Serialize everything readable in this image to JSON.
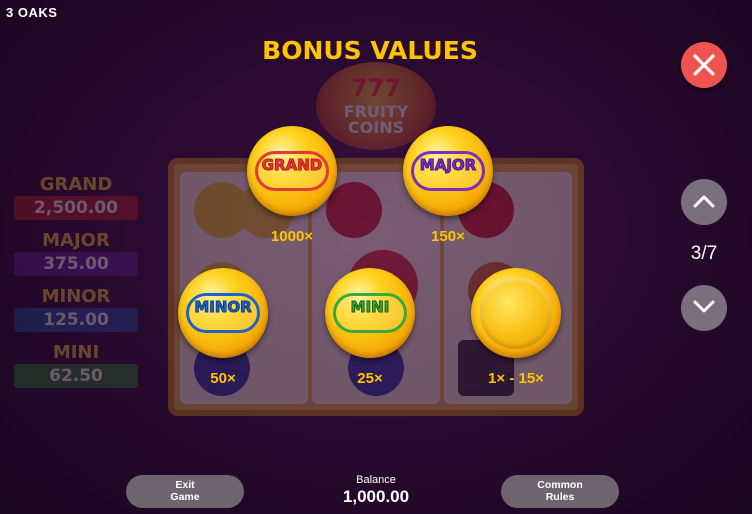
{
  "game": {
    "name": "3 OAKS"
  },
  "title": "BONUS VALUES",
  "pagination": {
    "indicator": "3/7"
  },
  "coins": [
    {
      "label": "GRAND",
      "multiplier": "1000×",
      "ring_color": "#e53935",
      "label_stroke": "#b71c1c"
    },
    {
      "label": "MAJOR",
      "multiplier": "150×",
      "ring_color": "#7b2fbe",
      "label_stroke": "#4a148c"
    },
    {
      "label": "MINOR",
      "multiplier": "50×",
      "ring_color": "#1e63c8",
      "label_stroke": "#0d3c8a"
    },
    {
      "label": "MINI",
      "multiplier": "25×",
      "ring_color": "#3aa83a",
      "label_stroke": "#1b5e20"
    },
    {
      "label": "",
      "multiplier": "1× - 15×",
      "ring_color": "",
      "label_stroke": ""
    }
  ],
  "background": {
    "logo": {
      "line1": "777",
      "line2": "FRUITY",
      "line3": "COINS"
    },
    "jackpots": [
      {
        "name": "GRAND",
        "value": "2,500.00",
        "color": "#b01e1e"
      },
      {
        "name": "MAJOR",
        "value": "375.00",
        "color": "#5a2090"
      },
      {
        "name": "MINOR",
        "value": "125.00",
        "color": "#1e4aa0"
      },
      {
        "name": "MINI",
        "value": "62.50",
        "color": "#2a7a2a"
      }
    ]
  },
  "footer": {
    "exit_button": {
      "line1": "Exit",
      "line2": "Game"
    },
    "balance": {
      "label": "Balance",
      "value": "1,000.00"
    },
    "rules_button": {
      "line1": "Common",
      "line2": "Rules"
    }
  },
  "icons": {
    "close": "close-icon",
    "up": "chevron-up-icon",
    "down": "chevron-down-icon"
  },
  "colors": {
    "title": "#ffc400",
    "close_bg": "#ef5350",
    "nav_bg": "#7a6f7d",
    "pill_bg": "#6d6470"
  }
}
